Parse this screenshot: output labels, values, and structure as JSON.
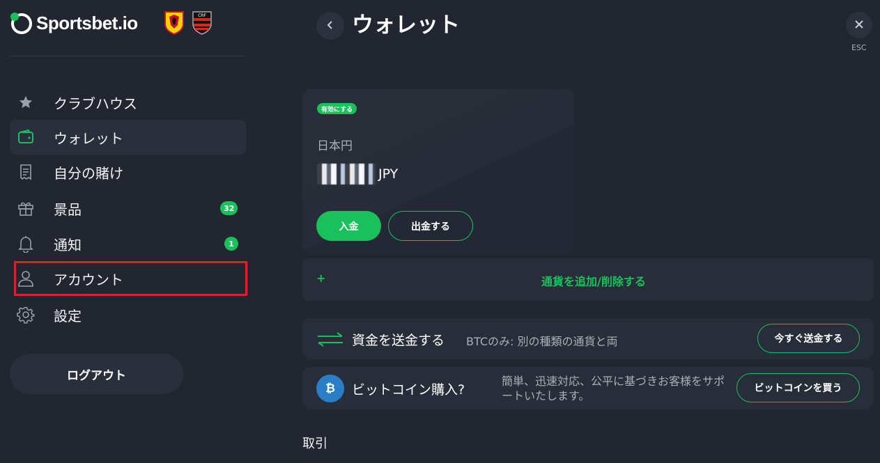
{
  "brand": {
    "name": "Sportsbet.io",
    "accent": "#1ac05b",
    "crests": [
      "watford-crest",
      "flamengo-crest"
    ]
  },
  "sidebar": {
    "items": [
      {
        "label": "クラブハウス",
        "icon": "star-icon"
      },
      {
        "label": "ウォレット",
        "icon": "wallet-icon",
        "active": true
      },
      {
        "label": "自分の賭け",
        "icon": "receipt-icon"
      },
      {
        "label": "景品",
        "icon": "gift-icon",
        "badge": "32"
      },
      {
        "label": "通知",
        "icon": "bell-icon",
        "badge": "1"
      },
      {
        "label": "アカウント",
        "icon": "user-icon",
        "highlighted": true
      },
      {
        "label": "設定",
        "icon": "gear-icon"
      }
    ],
    "logout_label": "ログアウト"
  },
  "header": {
    "title": "ウォレット",
    "esc_label": "ESC"
  },
  "wallet": {
    "active_tag": "有効にする",
    "currency_name": "日本円",
    "balance_unit": "JPY",
    "deposit_label": "入金",
    "withdraw_label": "出金する"
  },
  "add_currency": {
    "plus": "+",
    "label": "通貨を追加/削除する"
  },
  "transfer": {
    "title": "資金を送金する",
    "description": "BTCのみ: 別の種類の通貨と両",
    "button": "今すぐ送金する"
  },
  "buy_bitcoin": {
    "icon_glyph": "₿",
    "title": "ビットコイン購入?",
    "description": "簡単、迅速対応、公平に基づきお客様をサポートいたします。",
    "button": "ビットコインを買う"
  },
  "transactions": {
    "heading": "取引"
  }
}
